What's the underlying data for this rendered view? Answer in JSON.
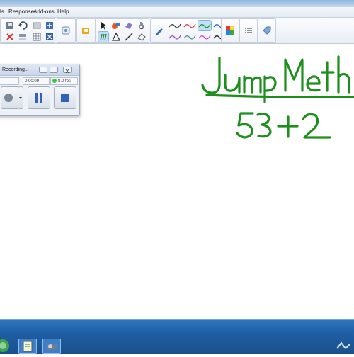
{
  "menu": {
    "items": [
      "ls",
      "Response",
      "Add-ons",
      "Help"
    ]
  },
  "toolbar": {
    "selected_pen": "green-pen",
    "icons": [
      "paste-icon",
      "undo-icon",
      "redo-icon",
      "insert-icon",
      "delete-icon",
      "table-icon",
      "screen-shade-icon",
      "tool-icon",
      "gallery-icon",
      "select-arrow-icon",
      "fill-icon",
      "eraser-icon",
      "touch-icon",
      "pens-icon",
      "shapes-icon",
      "line-icon",
      "eraser-tool-icon",
      "pen-icon",
      "color-palette-icon",
      "line-style-icon",
      "tag-icon"
    ]
  },
  "recorder": {
    "title": "Recording...",
    "time": "0:00:09",
    "rate": "8.0 fps",
    "status_color": "#2ecc40"
  },
  "colors": {
    "ink": "#1c8f1c",
    "taskbar": "#1f5fa4"
  }
}
